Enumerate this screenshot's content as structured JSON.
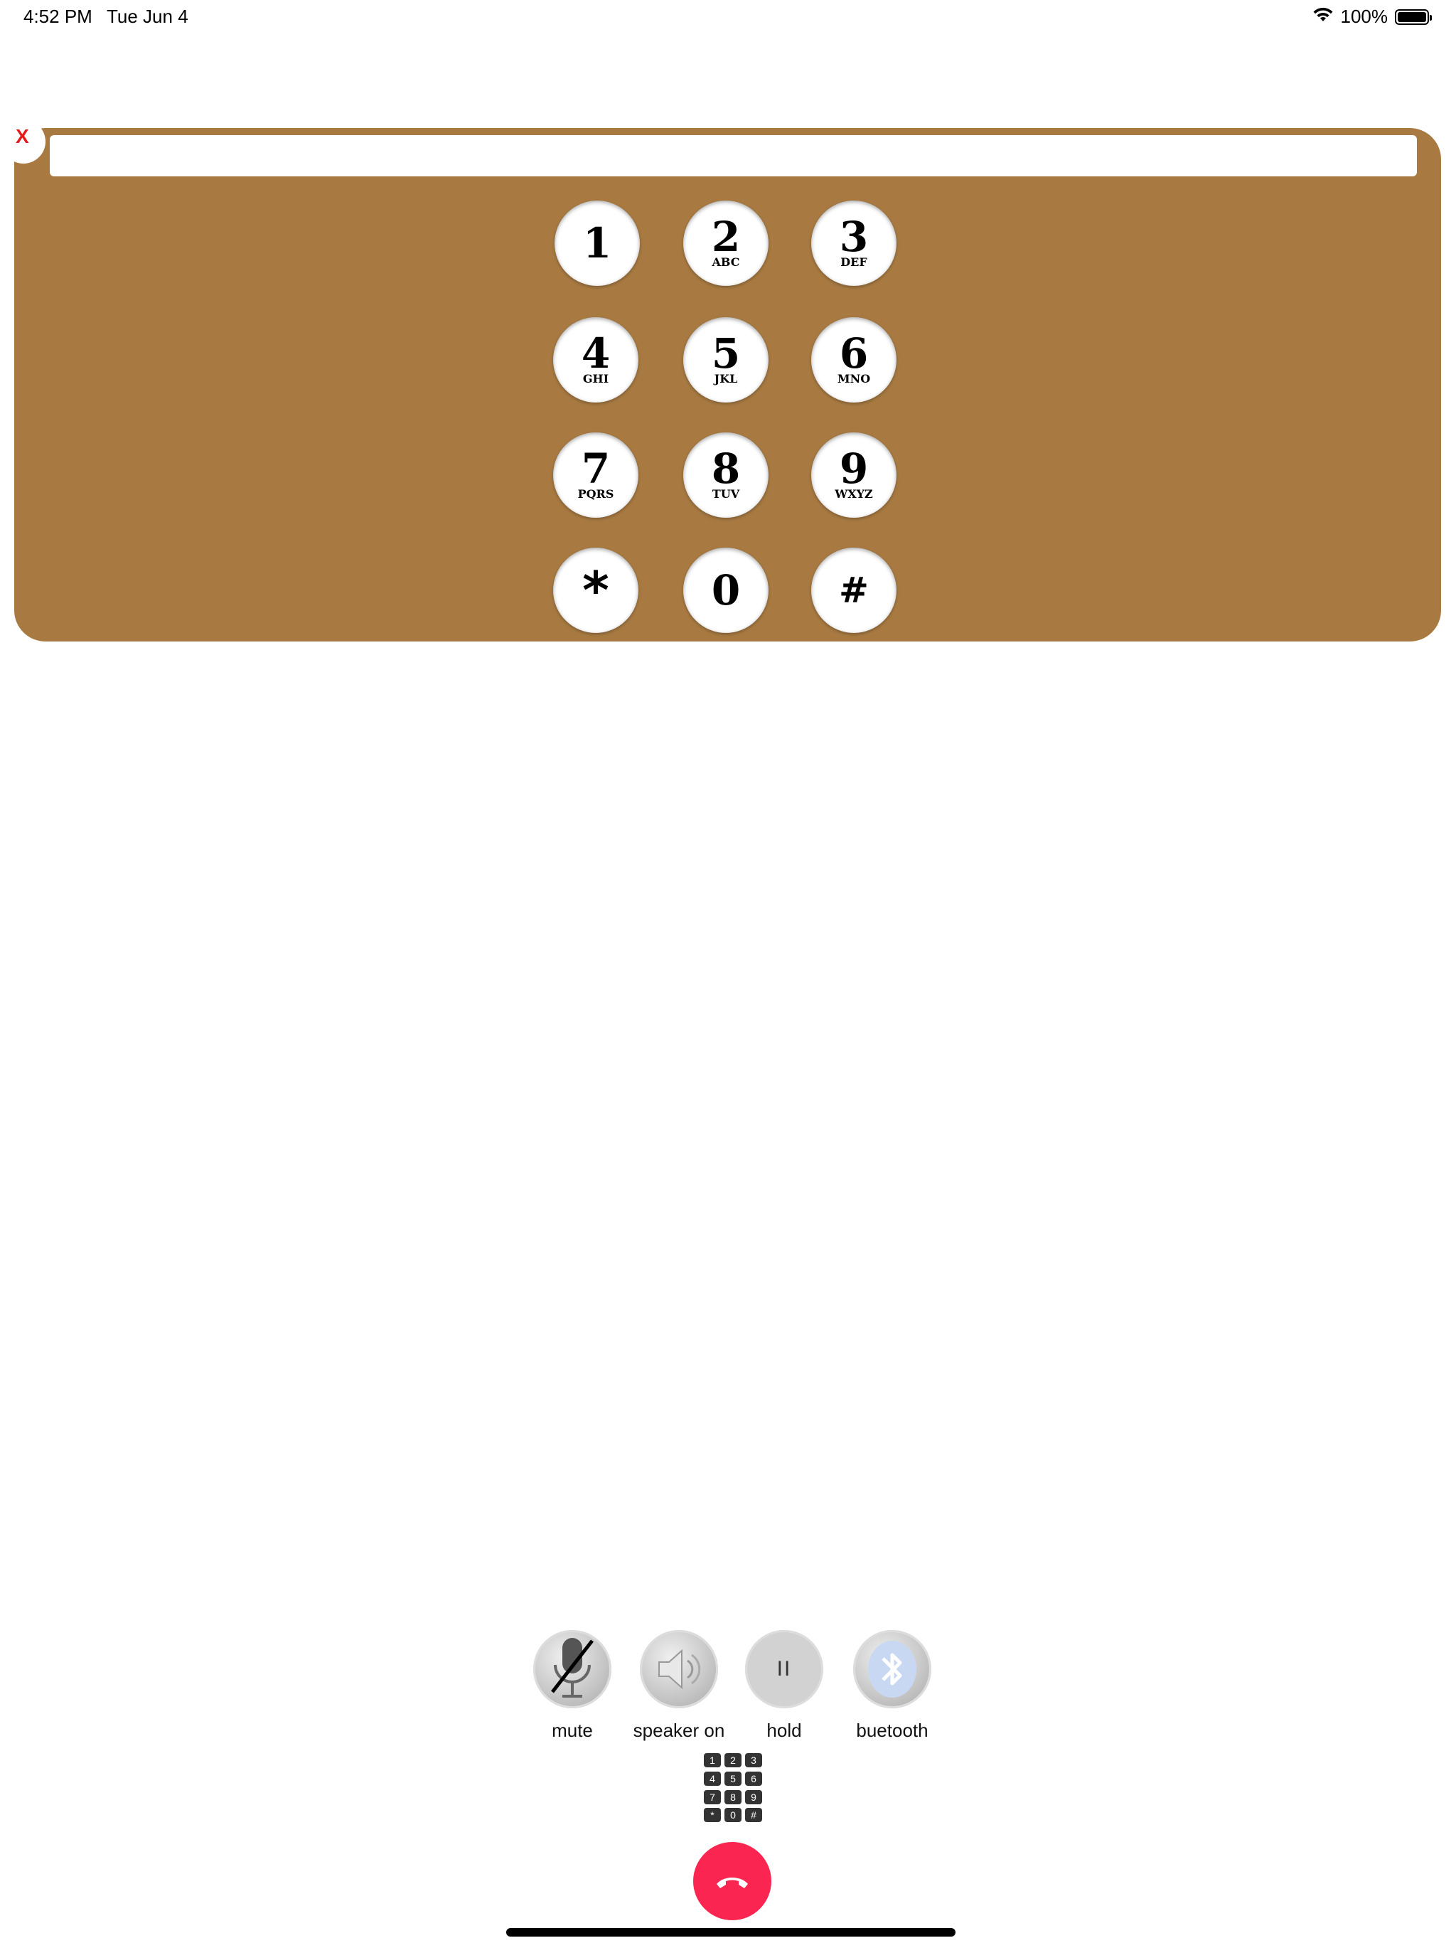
{
  "status_bar": {
    "time": "4:52 PM",
    "date": "Tue Jun 4",
    "battery": "100%"
  },
  "dialer": {
    "close_label": "X",
    "number_value": "",
    "keys": [
      {
        "digit": "1",
        "letters": ""
      },
      {
        "digit": "2",
        "letters": "ABC"
      },
      {
        "digit": "3",
        "letters": "DEF"
      },
      {
        "digit": "4",
        "letters": "GHI"
      },
      {
        "digit": "5",
        "letters": "JKL"
      },
      {
        "digit": "6",
        "letters": "MNO"
      },
      {
        "digit": "7",
        "letters": "PQRS"
      },
      {
        "digit": "8",
        "letters": "TUV"
      },
      {
        "digit": "9",
        "letters": "WXYZ"
      },
      {
        "digit": "*",
        "letters": ""
      },
      {
        "digit": "0",
        "letters": ""
      },
      {
        "digit": "#",
        "letters": ""
      }
    ],
    "panel_color": "#a87a42"
  },
  "controls": {
    "mute_label": "mute",
    "speaker_label": "speaker on",
    "hold_label": "hold",
    "bluetooth_label": "buetooth",
    "hold_symbol": "II"
  },
  "keypad_icon": [
    "1",
    "2",
    "3",
    "4",
    "5",
    "6",
    "7",
    "8",
    "9",
    "*",
    "0",
    "#"
  ],
  "end_call_color": "#fa2550"
}
